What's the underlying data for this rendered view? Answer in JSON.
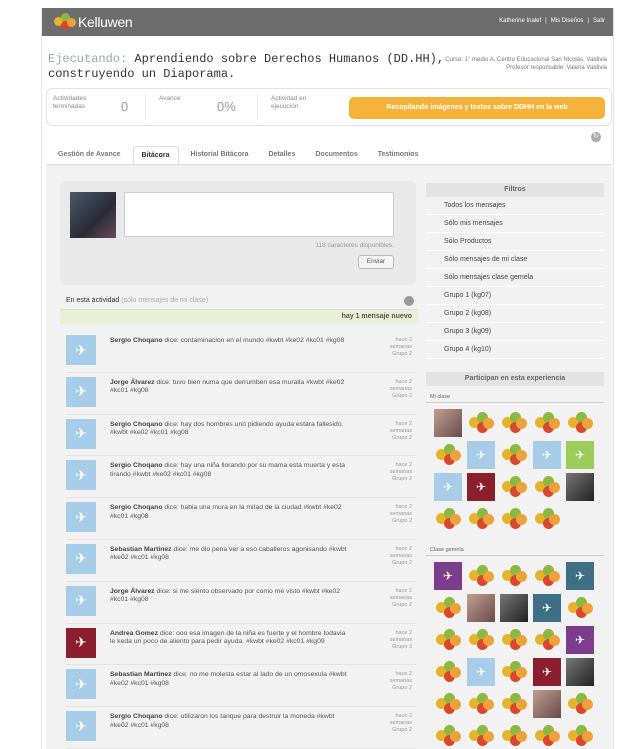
{
  "header": {
    "logo_text": "Kelluwen",
    "links": [
      "Katherine Inalef",
      "Mis Diseños",
      "Salir"
    ]
  },
  "title": {
    "prefix": "Ejecutando:",
    "text": "Aprendiendo sobre Derechos Humanos (DD.HH), construyendo un Diaporama."
  },
  "course": {
    "line1": "Curso: 1° medio A, Centro Educacional San Nicolás, Valdivia",
    "line2": "Profesor responsable: Valeria Valdivia"
  },
  "stats": {
    "done_label": "Actividades terminadas",
    "done_value": "0",
    "progress_label": "Avance",
    "progress_value": "0%",
    "current_label": "Actividad en ejecución",
    "current_value": "Recopilando imágenes y textos sobre DDHH en la web"
  },
  "tabs": [
    "Gestión de Avance",
    "Bitácora",
    "Historial Bitácora",
    "Detalles",
    "Documentos",
    "Testimonios"
  ],
  "composer": {
    "chars_left": "118 caracteres disponibles.",
    "send_label": "Enviar"
  },
  "activity": {
    "label": "En esta actividad",
    "hint": "(sólo mensajes de mi clase)",
    "new_messages": "hay 1 mensaje nuevo"
  },
  "messages": [
    {
      "author": "Sergio Choqano",
      "body": "dice: contaminacion en el mundo #kwbt #ke02 #kc01 #kg08",
      "time": "hace 2 semanas",
      "group": "Grupo 2",
      "red": false
    },
    {
      "author": "Jorge Álvarez",
      "body": "dice: tuvo bien numa que derrumben esa muralla #kwbt #ke02 #kc01 #kg08",
      "time": "hace 2 semanas",
      "group": "Grupo 2",
      "red": false
    },
    {
      "author": "Sergio Choqano",
      "body": "dice: hay dos hombres uno pidiendo ayuda estara fallesido #kwbt #ke02 #kc01 #kg08",
      "time": "hace 2 semanas",
      "group": "Grupo 2",
      "red": false
    },
    {
      "author": "Sergio Choqano",
      "body": "dice: hay una niña llorando por su mama esta muerta y esta tirando #kwbt #ke02 #kc01 #kg08",
      "time": "hace 2 semanas",
      "group": "Grupo 2",
      "red": false
    },
    {
      "author": "Sergio Choqano",
      "body": "dice: habia una mura en la mitad de la ciudad #kwbt #ke02 #kc01 #kg08",
      "time": "hace 2 semanas",
      "group": "Grupo 2",
      "red": false
    },
    {
      "author": "Sebastian Martinez",
      "body": "dice: me dio pena ver a eso caballeros agonisando #kwbt #ke02 #kc01 #kg08",
      "time": "hace 2 semanas",
      "group": "Grupo 2",
      "red": false
    },
    {
      "author": "Jorge Álvarez",
      "body": "dice: si me siento observado por como me visto #kwbt #ke02 #kc01 #kg08",
      "time": "hace 2 semanas",
      "group": "Grupo 2",
      "red": false
    },
    {
      "author": "Andrea Gomez",
      "body": "dice: ooo esa imagen de la niña es fuerte y el hombre todavia le keda un poco de aliento para pedir ayuda. #kwbt #ke02 #kc01 #kg09",
      "time": "hace 2 semanas",
      "group": "Grupo 3",
      "red": true
    },
    {
      "author": "Sebastian Martinez",
      "body": "dice: no me molesta estar al lado de un omosexula #kwbt #ke02 #kc01 #kg08",
      "time": "hace 2 semanas",
      "group": "Grupo 2",
      "red": false
    },
    {
      "author": "Sergio Choqano",
      "body": "dice: utilizaron los tanque para destruir la moneda #kwbt #ke02 #kc01 #kg08",
      "time": "hace 2 semanas",
      "group": "Grupo 2",
      "red": false
    }
  ],
  "filters": {
    "title": "Filtros",
    "items": [
      "Todos los mensajes",
      "Sólo mis mensajes",
      "Sólo Productos",
      "Sólo mensajes de mi clase",
      "Sólo mensajes clase gemela",
      "Grupo 1 (kg07)",
      "Grupo 2 (kg08)",
      "Grupo 3 (kg09)",
      "Grupo 4 (kg10)"
    ]
  },
  "participants": {
    "title": "Participan en esta experiencia",
    "my_class_label": "Mi clase",
    "twin_class_label": "Clase gemela",
    "my_class": [
      "photo",
      "logo",
      "logo",
      "logo",
      "logo",
      "logo",
      "tw-blue",
      "logo",
      "tw-blue",
      "tw-green",
      "tw-blue",
      "tw-red",
      "logo",
      "logo",
      "photo2",
      "logo",
      "logo",
      "logo",
      "logo"
    ],
    "twin_class": [
      "tw-purple",
      "logo",
      "logo",
      "logo",
      "tw-teal",
      "logo",
      "photo",
      "photo2",
      "tw-teal",
      "logo",
      "logo",
      "logo",
      "logo",
      "logo",
      "tw-purple",
      "logo",
      "tw-blue",
      "logo",
      "tw-red",
      "photo2",
      "logo",
      "logo",
      "logo",
      "photo",
      "logo",
      "logo",
      "logo",
      "logo",
      "logo",
      "logo"
    ]
  },
  "colors": {
    "accent": "#f6b33a",
    "twitter_blue": "#a7cde8",
    "twitter_red": "#8b1f2e"
  }
}
